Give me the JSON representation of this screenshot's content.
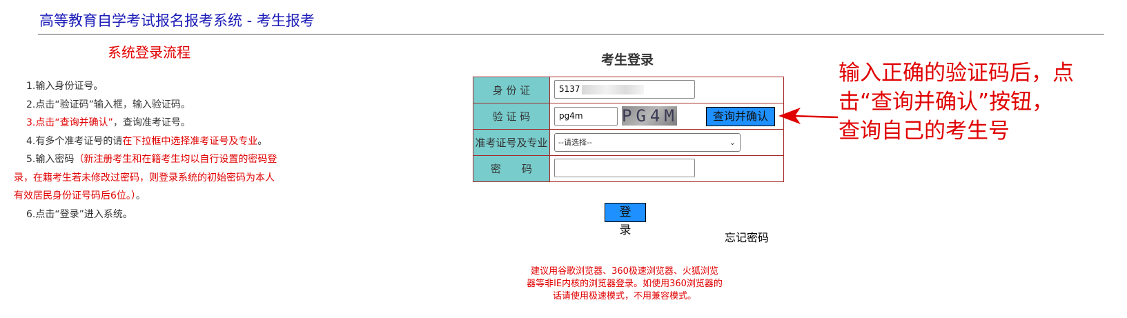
{
  "header": {
    "title": "高等教育自学考试报名报考系统 - 考生报考"
  },
  "flow": {
    "title": "系统登录流程",
    "steps": {
      "s1": "1.输入身份证号。",
      "s2": "2.点击“验证码”输入框，输入验证码。",
      "s3_red": "3.点击“查询并确认”",
      "s3_rest": "，查询准考证号。",
      "s4_a": "4.有多个准考证号的请",
      "s4_red": "在下拉框中选择准考证号及专业",
      "s4_end": "。",
      "s5_a": "5.输入密码",
      "s5_red1": "（新注册考生和在籍考生均以自行设置的密码登",
      "s5_red2": "录，在籍考生若未修改过密码，则登录系统的初始密码为本人",
      "s5_red3": "有效居民身份证号码后6位。）",
      "s5_end": "。",
      "s6": "6.点击“登录”进入系统。"
    }
  },
  "login": {
    "title": "考生登录",
    "id_label": "身 份 证",
    "id_value": "5137",
    "captcha_label": "验 证 码",
    "captcha_value": "pg4m",
    "captcha_image_text": "PG4M",
    "query_button": "查询并确认",
    "exam_label": "准考证号及专业",
    "exam_select_value": "--请选择--",
    "password_label": "密　　码",
    "password_value": "",
    "login_button": "登 录",
    "forgot_password": "忘记密码"
  },
  "browser_note": {
    "line1": "建议用谷歌浏览器、360极速浏览器、火狐浏览",
    "line2": "器等非IE内核的浏览器登录。如使用360浏览器的",
    "line3": "话请使用极速模式，不用兼容模式。"
  },
  "annotation": {
    "line1": "输入正确的验证码后，点",
    "line2": "击“查询并确认”按钮，",
    "line3": "查询自己的考生号",
    "color": "#e00000"
  },
  "colors": {
    "label_bg": "#79cccc",
    "button_bg": "#1e90ff",
    "border": "#a52a2a",
    "title_blue": "#1a1ab8",
    "red": "#e00000"
  }
}
